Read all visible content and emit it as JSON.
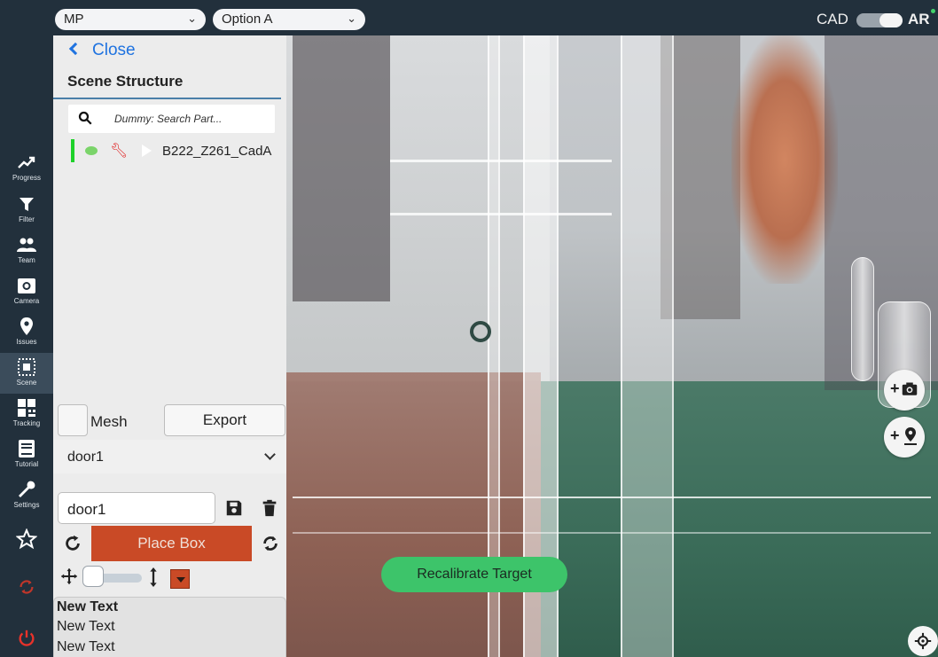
{
  "topbar": {
    "project_select": "MP",
    "option_select": "Option A",
    "mode_cad": "CAD",
    "mode_ar": "AR"
  },
  "nav": [
    {
      "label": "Progress",
      "icon": "progress-icon"
    },
    {
      "label": "Filter",
      "icon": "filter-icon"
    },
    {
      "label": "Team",
      "icon": "team-icon"
    },
    {
      "label": "Camera",
      "icon": "camera-icon"
    },
    {
      "label": "Issues",
      "icon": "issues-icon"
    },
    {
      "label": "Scene",
      "icon": "scene-icon",
      "active": true
    },
    {
      "label": "Tracking",
      "icon": "tracking-icon"
    },
    {
      "label": "Tutorial",
      "icon": "tutorial-icon"
    },
    {
      "label": "Settings",
      "icon": "settings-icon"
    }
  ],
  "panel": {
    "close_label": "Close",
    "title": "Scene Structure",
    "search_placeholder": "Dummy: Search Part...",
    "tree_item": "B222_Z261_CadA",
    "mesh_label": "Mesh",
    "export_label": "Export",
    "dropdown_value": "door1",
    "name_input_value": "door1",
    "place_box_label": "Place Box",
    "text_lines": [
      "New Text",
      "New Text",
      "New Text"
    ]
  },
  "recalibrate_label": "Recalibrate Target",
  "colors": {
    "rail": "#22303c",
    "accent_blue": "#1f73e0",
    "place_box": "#c94a26",
    "recalibrate": "#3dc46a"
  }
}
